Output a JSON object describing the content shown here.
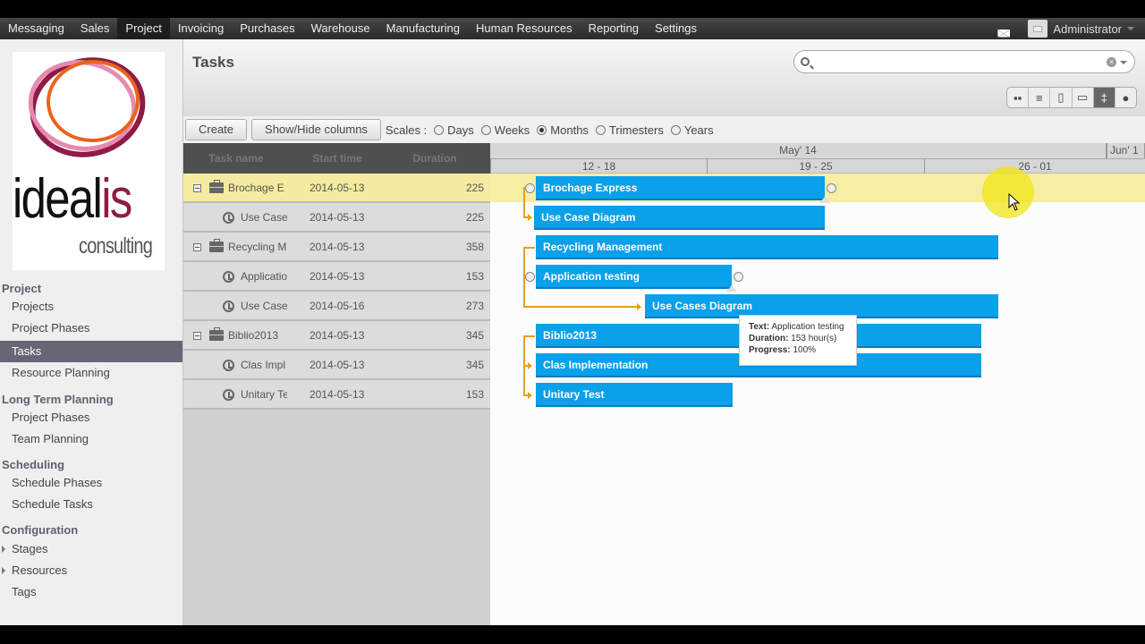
{
  "topbar": {
    "menu": [
      {
        "label": "Messaging",
        "active": false
      },
      {
        "label": "Sales",
        "active": false
      },
      {
        "label": "Project",
        "active": true
      },
      {
        "label": "Invoicing",
        "active": false
      },
      {
        "label": "Purchases",
        "active": false
      },
      {
        "label": "Warehouse",
        "active": false
      },
      {
        "label": "Manufacturing",
        "active": false
      },
      {
        "label": "Human Resources",
        "active": false
      },
      {
        "label": "Reporting",
        "active": false
      },
      {
        "label": "Settings",
        "active": false
      }
    ],
    "user": "Administrator",
    "icons": {
      "mail": "mail-icon",
      "avatar": "avatar-icon",
      "menu": "chevron-down-icon"
    }
  },
  "logo": {
    "main": "ideal",
    "accent": "is",
    "sub": "consulting",
    "accent_color": "#8e1b47"
  },
  "sidebar": {
    "sections": [
      {
        "title": "Project",
        "items": [
          {
            "label": "Projects",
            "active": false
          },
          {
            "label": "Project Phases",
            "active": false
          },
          {
            "label": "Tasks",
            "active": true
          },
          {
            "label": "Resource Planning",
            "active": false
          }
        ]
      },
      {
        "title": "Long Term Planning",
        "items": [
          {
            "label": "Project Phases",
            "active": false
          },
          {
            "label": "Team Planning",
            "active": false
          }
        ]
      },
      {
        "title": "Scheduling",
        "items": [
          {
            "label": "Schedule Phases",
            "active": false
          },
          {
            "label": "Schedule Tasks",
            "active": false
          }
        ]
      },
      {
        "title": "Configuration",
        "items": [
          {
            "label": "Stages",
            "expandable": true
          },
          {
            "label": "Resources",
            "expandable": true
          },
          {
            "label": "Tags",
            "expandable": false
          }
        ]
      }
    ]
  },
  "header": {
    "title": "Tasks",
    "search": {
      "value": "",
      "placeholder": ""
    },
    "views": [
      "kanban",
      "list",
      "form",
      "calendar",
      "gantt",
      "graph"
    ],
    "active_view": "gantt"
  },
  "toolbar": {
    "create_label": "Create",
    "columns_label": "Show/Hide columns",
    "scales_label": "Scales :",
    "scales": [
      {
        "label": "Days",
        "checked": false
      },
      {
        "label": "Weeks",
        "checked": false
      },
      {
        "label": "Months",
        "checked": true
      },
      {
        "label": "Trimesters",
        "checked": false
      },
      {
        "label": "Years",
        "checked": false
      }
    ]
  },
  "grid": {
    "columns": [
      "Task name",
      "Start time",
      "Duration"
    ],
    "rows": [
      {
        "name": "Brochage E",
        "full_name": "Brochage Express",
        "start": "2014-05-13",
        "duration": "225",
        "type": "project",
        "selected": true
      },
      {
        "name": "Use Case",
        "full_name": "Use Case Diagram",
        "start": "2014-05-13",
        "duration": "225",
        "type": "task"
      },
      {
        "name": "Recycling M",
        "full_name": "Recycling Management",
        "start": "2014-05-13",
        "duration": "358",
        "type": "project"
      },
      {
        "name": "Applicatio",
        "full_name": "Application testing",
        "start": "2014-05-13",
        "duration": "153",
        "type": "task"
      },
      {
        "name": "Use Case",
        "full_name": "Use Cases Diagram",
        "start": "2014-05-16",
        "duration": "273",
        "type": "task"
      },
      {
        "name": "Biblio2013",
        "full_name": "Biblio2013",
        "start": "2014-05-13",
        "duration": "345",
        "type": "project"
      },
      {
        "name": "Clas Impl",
        "full_name": "Clas Implementation",
        "start": "2014-05-13",
        "duration": "345",
        "type": "task"
      },
      {
        "name": "Unitary Te",
        "full_name": "Unitary Test",
        "start": "2014-05-13",
        "duration": "153",
        "type": "task"
      }
    ]
  },
  "timeline": {
    "months": [
      "May' 14",
      "Jun' 1"
    ],
    "weeks": [
      "12 - 18",
      "19 - 25",
      "26 - 01"
    ]
  },
  "tooltip": {
    "text_label": "Text:",
    "text_value": "Application testing",
    "duration_label": "Duration:",
    "duration_value": "153 hour(s)",
    "progress_label": "Progress:",
    "progress_value": "100%"
  },
  "colors": {
    "bar": "#0aa0ea",
    "link": "#e8a020",
    "selected_row": "#f5eba0",
    "active_nav": "#666677"
  }
}
